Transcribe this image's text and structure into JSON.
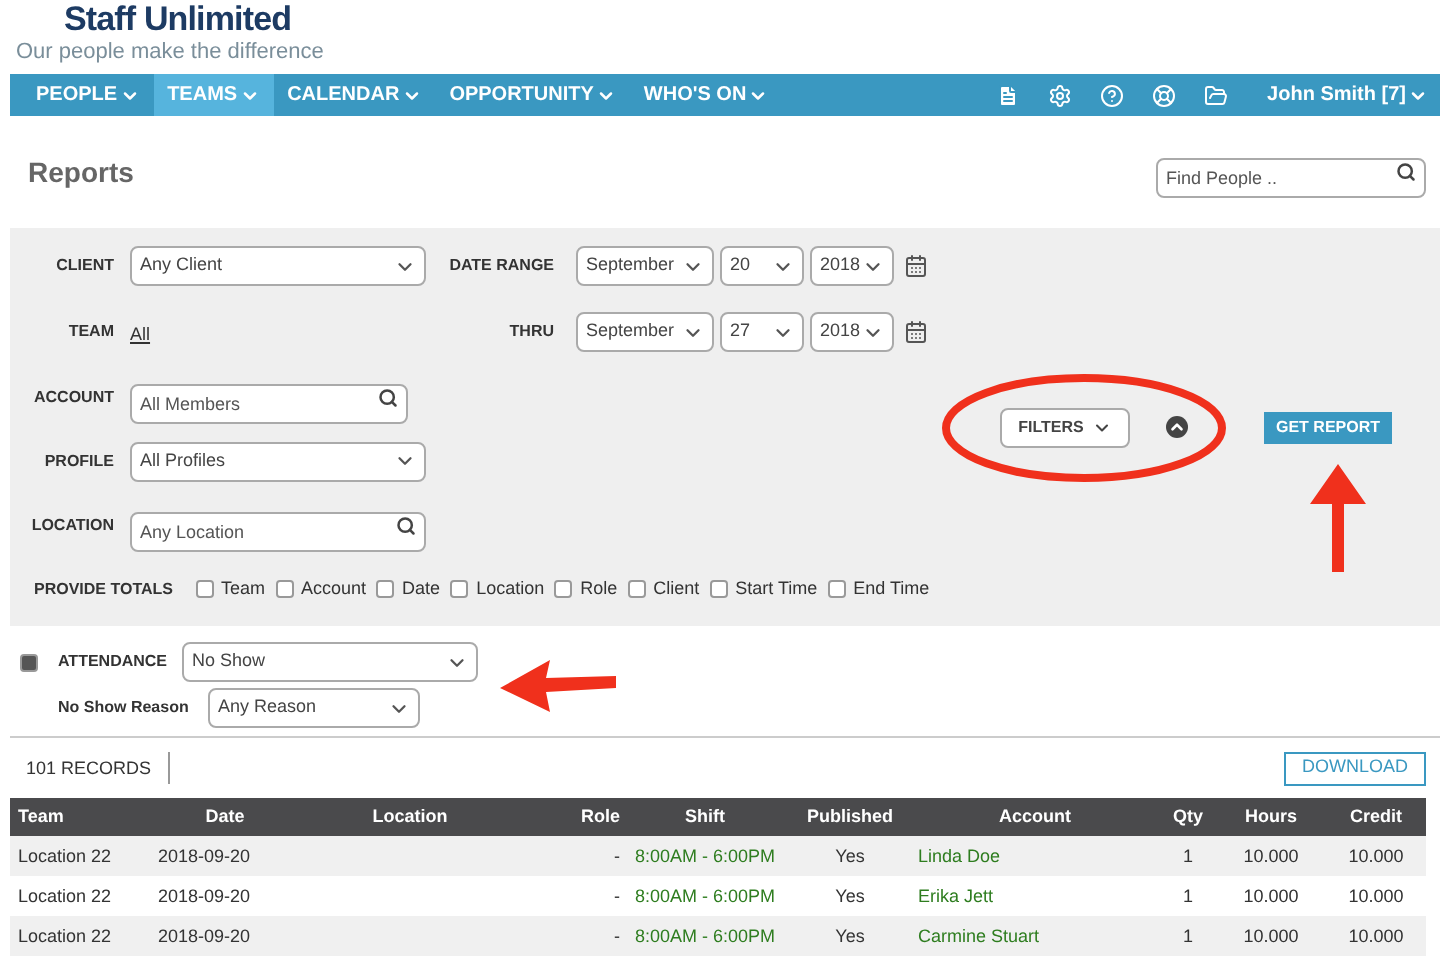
{
  "brand": {
    "title": "Staff Unlimited",
    "tagline": "Our people make the difference"
  },
  "nav": {
    "items": [
      {
        "label": "PEOPLE",
        "selected": false
      },
      {
        "label": "TEAMS",
        "selected": true
      },
      {
        "label": "CALENDAR",
        "selected": false
      },
      {
        "label": "OPPORTUNITY",
        "selected": false
      },
      {
        "label": "WHO'S ON",
        "selected": false
      }
    ],
    "user": "John Smith [7]"
  },
  "page_title": "Reports",
  "find_people": {
    "placeholder": "Find People .."
  },
  "filters": {
    "client": {
      "label": "CLIENT",
      "value": "Any Client"
    },
    "team": {
      "label": "TEAM",
      "value": "All"
    },
    "account": {
      "label": "ACCOUNT",
      "placeholder": "All Members"
    },
    "profile": {
      "label": "PROFILE",
      "value": "All Profiles"
    },
    "location": {
      "label": "LOCATION",
      "placeholder": "Any Location"
    },
    "date_range": {
      "label": "DATE RANGE",
      "month": "September",
      "day": "20",
      "year": "2018"
    },
    "thru": {
      "label": "THRU",
      "month": "September",
      "day": "27",
      "year": "2018"
    },
    "filters_button": "FILTERS",
    "get_report": "GET REPORT",
    "totals": {
      "label": "PROVIDE TOTALS",
      "options": [
        {
          "label": "Team",
          "checked": false
        },
        {
          "label": "Account",
          "checked": false
        },
        {
          "label": "Date",
          "checked": false
        },
        {
          "label": "Location",
          "checked": false
        },
        {
          "label": "Role",
          "checked": false
        },
        {
          "label": "Client",
          "checked": false
        },
        {
          "label": "Start Time",
          "checked": false
        },
        {
          "label": "End Time",
          "checked": false
        }
      ]
    }
  },
  "attendance": {
    "checked": true,
    "label": "ATTENDANCE",
    "value": "No Show",
    "reason_label": "No Show Reason",
    "reason_value": "Any Reason"
  },
  "records": {
    "count": "101 RECORDS",
    "download": "DOWNLOAD"
  },
  "table": {
    "columns": [
      "Team",
      "Date",
      "Location",
      "Role",
      "Shift",
      "Published",
      "Account",
      "Qty",
      "Hours",
      "Credit"
    ],
    "rows": [
      [
        "Location 22",
        "2018-09-20",
        "",
        "-",
        "8:00AM - 6:00PM",
        "Yes",
        "Linda Doe",
        "1",
        "10.000",
        "10.000"
      ],
      [
        "Location 22",
        "2018-09-20",
        "",
        "-",
        "8:00AM - 6:00PM",
        "Yes",
        "Erika Jett",
        "1",
        "10.000",
        "10.000"
      ],
      [
        "Location 22",
        "2018-09-20",
        "",
        "-",
        "8:00AM - 6:00PM",
        "Yes",
        "Carmine Stuart",
        "1",
        "10.000",
        "10.000"
      ]
    ]
  }
}
